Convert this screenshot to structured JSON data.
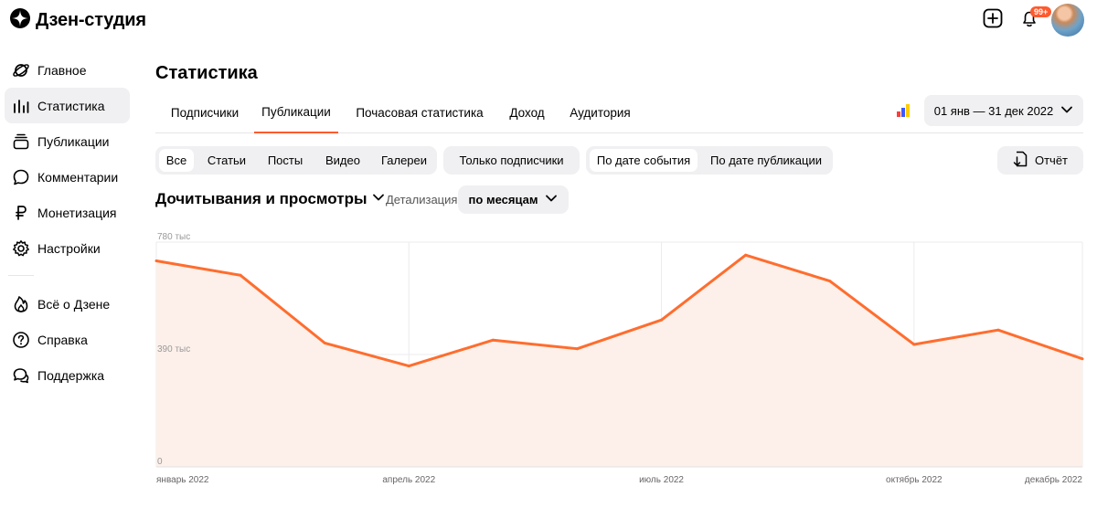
{
  "app": {
    "logo_text": "Дзен-студия",
    "notification_badge": "99+"
  },
  "sidebar": {
    "items": [
      {
        "label": "Главное",
        "icon": "planet-icon",
        "active": false
      },
      {
        "label": "Статистика",
        "icon": "bar-chart-icon",
        "active": true
      },
      {
        "label": "Публикации",
        "icon": "stack-icon",
        "active": false
      },
      {
        "label": "Комментарии",
        "icon": "comment-icon",
        "active": false
      },
      {
        "label": "Монетизация",
        "icon": "ruble-icon",
        "active": false
      },
      {
        "label": "Настройки",
        "icon": "gear-icon",
        "active": false
      }
    ],
    "secondary": [
      {
        "label": "Всё о Дзене",
        "icon": "flame-icon"
      },
      {
        "label": "Справка",
        "icon": "help-icon"
      },
      {
        "label": "Поддержка",
        "icon": "support-icon"
      }
    ]
  },
  "page": {
    "title": "Статистика",
    "tabs": [
      "Подписчики",
      "Публикации",
      "Почасовая статистика",
      "Доход",
      "Аудитория"
    ],
    "active_tab": "Публикации",
    "date_range": "01 янв — 31 дек 2022"
  },
  "filters": {
    "types": [
      "Все",
      "Статьи",
      "Посты",
      "Видео",
      "Галереи"
    ],
    "selected_type": "Все",
    "subscribers_only": "Только подписчики",
    "date_modes": [
      "По дате события",
      "По дате публикации"
    ],
    "selected_date_mode": "По дате события",
    "report_label": "Отчёт"
  },
  "metric": {
    "label": "Дочитывания и просмотры",
    "detail_label": "Детализация",
    "detail_value": "по месяцам"
  },
  "colors": {
    "accent": "#ff6d2e",
    "area_fill": "#fdf0ea",
    "tab_underline": "#ff5a2e"
  },
  "chart_data": {
    "type": "area",
    "x": [
      "2022-01",
      "2022-02",
      "2022-03",
      "2022-04",
      "2022-05",
      "2022-06",
      "2022-07",
      "2022-08",
      "2022-09",
      "2022-10",
      "2022-11",
      "2022-12"
    ],
    "values": [
      715000,
      665000,
      430000,
      350000,
      440000,
      410000,
      510000,
      735000,
      645000,
      425000,
      475000,
      375000
    ],
    "ylim": [
      0,
      780000
    ],
    "y_ticks": [
      "0",
      "390 тыс",
      "780 тыс"
    ],
    "x_tick_labels": [
      "январь 2022",
      "апрель 2022",
      "июль 2022",
      "октябрь 2022",
      "декабрь 2022"
    ],
    "grid": true
  }
}
